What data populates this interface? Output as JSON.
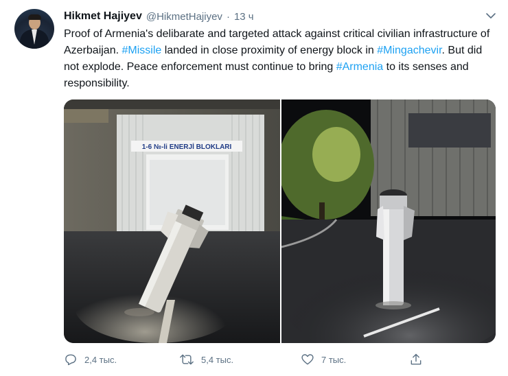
{
  "author": {
    "name": "Hikmet Hajiyev",
    "handle": "@HikmetHajiyev",
    "separator": "·",
    "time": "13 ч"
  },
  "tweet": {
    "segments": [
      {
        "text": "Proof of Armenia's delibarate and targeted attack against critical civilian infrastructure of Azerbaijan. ",
        "tag": false
      },
      {
        "text": "#Missile",
        "tag": true
      },
      {
        "text": " landed in close proximity of energy block in ",
        "tag": false
      },
      {
        "text": "#Mingachevir",
        "tag": true
      },
      {
        "text": ". But did not explode. Peace enforcement must continue to bring ",
        "tag": false
      },
      {
        "text": "#Armenia",
        "tag": true
      },
      {
        "text": " to its senses and responsibility.",
        "tag": false
      }
    ]
  },
  "photos": {
    "left_sign": "1-6 №-li ENERJİ BLOKLARI"
  },
  "actions": {
    "reply_count": "2,4 тыс.",
    "retweet_count": "5,4 тыс.",
    "like_count": "7 тыс."
  },
  "colors": {
    "link": "#1da1f2",
    "secondary_text": "#5b7083",
    "icon": "#5b7083"
  },
  "icons": [
    "chevron-down-icon",
    "reply-icon",
    "retweet-icon",
    "like-icon",
    "share-icon"
  ]
}
